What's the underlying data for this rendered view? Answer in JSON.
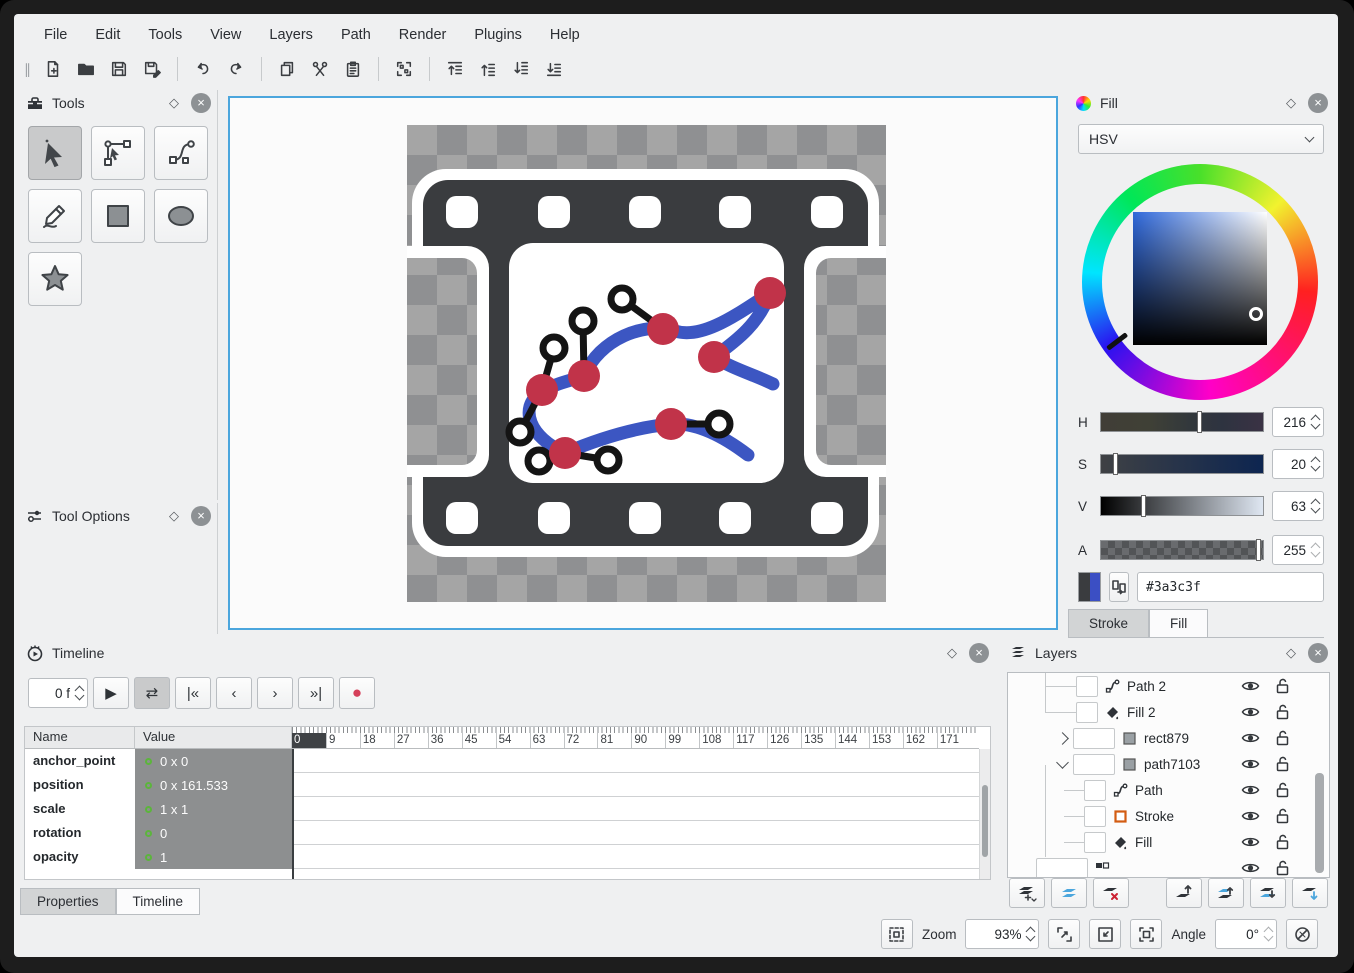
{
  "menu": {
    "items": [
      "File",
      "Edit",
      "Tools",
      "View",
      "Layers",
      "Path",
      "Render",
      "Plugins",
      "Help"
    ]
  },
  "panels": {
    "tools": {
      "title": "Tools"
    },
    "tool_options": {
      "title": "Tool Options"
    },
    "fill": {
      "title": "Fill",
      "color_model": "HSV",
      "sliders": {
        "h": {
          "label": "H",
          "value": "216"
        },
        "s": {
          "label": "S",
          "value": "20"
        },
        "v": {
          "label": "V",
          "value": "63"
        },
        "a": {
          "label": "A",
          "value": "255"
        }
      },
      "hex": "#3a3c3f",
      "tabs": {
        "stroke": "Stroke",
        "fill": "Fill"
      }
    },
    "timeline": {
      "title": "Timeline",
      "frame_spin": "0 f",
      "columns": {
        "name": "Name",
        "value": "Value"
      },
      "rows": [
        {
          "name": "anchor_point",
          "value": "0 x 0"
        },
        {
          "name": "position",
          "value": "0 x 161.533"
        },
        {
          "name": "scale",
          "value": "1 x 1"
        },
        {
          "name": "rotation",
          "value": "0"
        },
        {
          "name": "opacity",
          "value": "1"
        }
      ],
      "ruler": [
        "0",
        "9",
        "18",
        "27",
        "36",
        "45",
        "54",
        "63",
        "72",
        "81",
        "90",
        "99",
        "108",
        "117",
        "126",
        "135",
        "144",
        "153",
        "162",
        "171"
      ]
    },
    "layers": {
      "title": "Layers",
      "rows": [
        {
          "label": "Path 2"
        },
        {
          "label": "Fill 2"
        },
        {
          "label": "rect879"
        },
        {
          "label": "path7103"
        },
        {
          "label": "Path"
        },
        {
          "label": "Stroke"
        },
        {
          "label": "Fill"
        }
      ]
    }
  },
  "bottom_tabs": {
    "properties": "Properties",
    "timeline": "Timeline"
  },
  "statusbar": {
    "zoom_label": "Zoom",
    "zoom_value": "93%",
    "angle_label": "Angle",
    "angle_value": "0°"
  },
  "colors": {
    "canvas_selection_border": "#4ba6dd",
    "film_dark": "#3a3c3f",
    "path_blue": "#3c56c2",
    "node_red": "#c13349",
    "swatch_left": "#3a3c3f",
    "swatch_right": "#3b4fc4"
  },
  "icons": {
    "play": "▶",
    "loop": "⇄",
    "skip_start": "|«",
    "prev": "‹",
    "next": "›",
    "skip_end": "»|",
    "record": "●",
    "float_dock": "◇",
    "close_dock": "×",
    "toolbar_handle": "∥"
  }
}
